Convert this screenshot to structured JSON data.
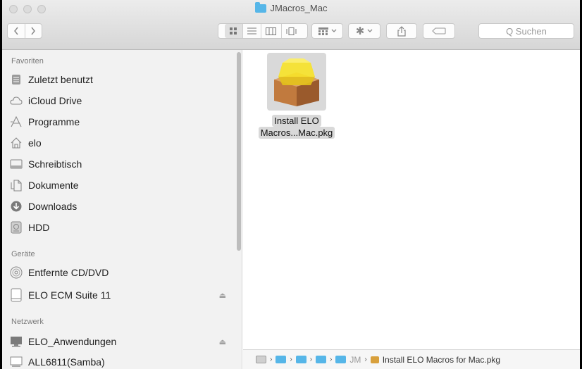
{
  "window": {
    "title": "JMacros_Mac"
  },
  "toolbar": {
    "back_icon": "chevron-left-icon",
    "forward_icon": "chevron-right-icon",
    "search_placeholder": "Q Suchen"
  },
  "sidebar": {
    "sections": [
      {
        "title": "Favoriten"
      },
      {
        "title": "Geräte"
      },
      {
        "title": "Netzwerk"
      }
    ],
    "favorites": [
      {
        "label": "Zuletzt benutzt",
        "icon": "recents-icon"
      },
      {
        "label": "iCloud Drive",
        "icon": "cloud-icon"
      },
      {
        "label": "Programme",
        "icon": "applications-icon"
      },
      {
        "label": "elo",
        "icon": "home-icon"
      },
      {
        "label": "Schreibtisch",
        "icon": "desktop-icon"
      },
      {
        "label": "Dokumente",
        "icon": "documents-icon"
      },
      {
        "label": "Downloads",
        "icon": "downloads-icon"
      },
      {
        "label": "HDD",
        "icon": "hard-drive-icon"
      }
    ],
    "devices": [
      {
        "label": "Entfernte CD/DVD",
        "icon": "disc-icon"
      },
      {
        "label": "ELO ECM Suite 11",
        "icon": "drive-icon",
        "eject": true
      }
    ],
    "network": [
      {
        "label": "ELO_Anwendungen",
        "icon": "server-icon",
        "eject": true
      },
      {
        "label": "ALL6811(Samba)",
        "icon": "network-pc-icon"
      }
    ],
    "eject_glyph": "⏏"
  },
  "content": {
    "files": [
      {
        "line1": "Install ELO",
        "line2": "Macros...Mac.pkg",
        "icon": "package-icon",
        "selected": true
      }
    ]
  },
  "pathbar": {
    "truncated_segment": "JM",
    "file": "Install ELO Macros for Mac.pkg"
  }
}
